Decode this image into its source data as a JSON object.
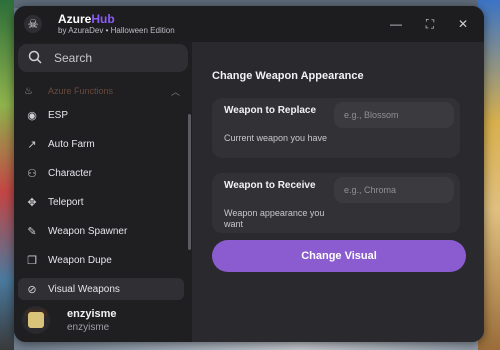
{
  "app": {
    "title_a": "Azure",
    "title_b": "Hub",
    "subtitle": "by AzuraDev • Halloween Edition",
    "logo_icon": "skull-icon",
    "accent_color": "#8b5cf6"
  },
  "window_controls": {
    "minimize": "—",
    "maximize": "⛶",
    "close": "✕"
  },
  "search": {
    "placeholder": "Search",
    "value": ""
  },
  "sidebar": {
    "section_label": "Azure Functions",
    "items": [
      {
        "label": "ESP",
        "icon": "eye-icon",
        "glyph": "◉"
      },
      {
        "label": "Auto Farm",
        "icon": "trend-icon",
        "glyph": "↗"
      },
      {
        "label": "Character",
        "icon": "user-icon",
        "glyph": "⚇"
      },
      {
        "label": "Teleport",
        "icon": "move-icon",
        "glyph": "✥"
      },
      {
        "label": "Weapon Spawner",
        "icon": "brush-icon",
        "glyph": "✎"
      },
      {
        "label": "Weapon Dupe",
        "icon": "copy-icon",
        "glyph": "❐"
      },
      {
        "label": "Visual Weapons",
        "icon": "eye-off-icon",
        "glyph": "⊘",
        "active": true
      }
    ]
  },
  "user": {
    "name": "enzyisme",
    "handle": "enzyisme"
  },
  "main": {
    "title": "Change Weapon Appearance",
    "fields": [
      {
        "label": "Weapon to Replace",
        "hint": "Current weapon you have",
        "placeholder": "e.g., Blossom",
        "value": ""
      },
      {
        "label": "Weapon to Receive",
        "hint": "Weapon appearance you want",
        "placeholder": "e.g., Chroma",
        "value": ""
      }
    ],
    "button_label": "Change Visual"
  }
}
